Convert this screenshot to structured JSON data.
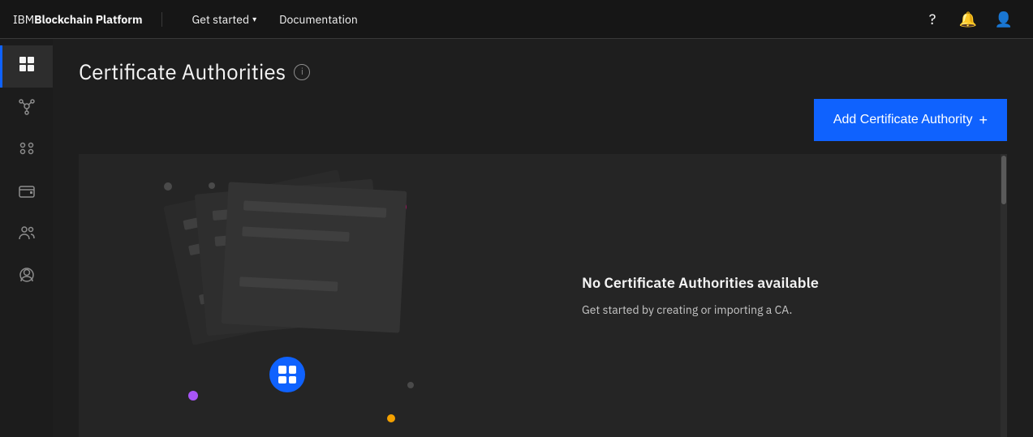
{
  "topnav": {
    "brand_normal": "IBM ",
    "brand_bold": "Blockchain Platform",
    "get_started_label": "Get started",
    "documentation_label": "Documentation"
  },
  "sidebar": {
    "items": [
      {
        "id": "dashboard",
        "icon": "⊞",
        "label": "Dashboard",
        "active": true
      },
      {
        "id": "network",
        "icon": "⬡",
        "label": "Network",
        "active": false
      },
      {
        "id": "nodes",
        "icon": "⚙",
        "label": "Nodes",
        "active": false
      },
      {
        "id": "wallet",
        "icon": "▣",
        "label": "Wallet",
        "active": false
      },
      {
        "id": "users",
        "icon": "👥",
        "label": "Users",
        "active": false
      },
      {
        "id": "identity",
        "icon": "👤",
        "label": "Identity",
        "active": false
      }
    ]
  },
  "page": {
    "title": "Certificate Authorities",
    "info_icon_label": "i"
  },
  "toolbar": {
    "add_button_label": "Add Certificate Authority",
    "add_button_icon": "+"
  },
  "empty_state": {
    "title": "No Certificate Authorities available",
    "description": "Get started by creating or importing a CA."
  },
  "colors": {
    "accent_blue": "#0f62fe",
    "dot_pink": "#e6007e",
    "dot_purple": "#a855f7",
    "dot_orange": "#f4a100",
    "dot_gray": "#4a4a4a"
  }
}
